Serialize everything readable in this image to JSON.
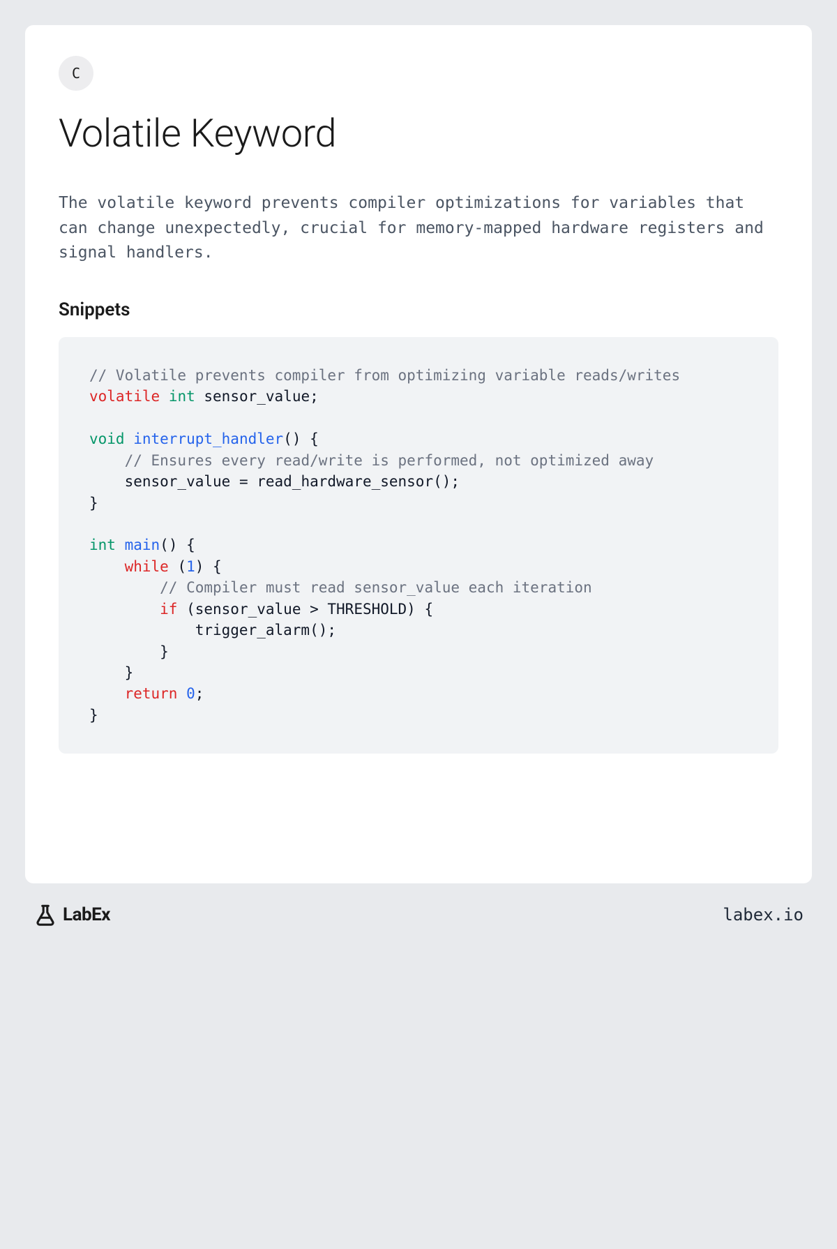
{
  "lang_badge": "C",
  "title": "Volatile Keyword",
  "description": "The volatile keyword prevents compiler optimizations for variables that can change unexpectedly, crucial for memory-mapped hardware registers and signal handlers.",
  "section_heading": "Snippets",
  "code": {
    "c1": "// Volatile prevents compiler from optimizing variable reads/writes",
    "kw_volatile": "volatile",
    "kw_int1": "int",
    "var_sensor": " sensor_value;",
    "kw_void": "void",
    "fn_interrupt": "interrupt_handler",
    "paren_brace1": "() {",
    "c2": "// Ensures every read/write is performed, not optimized away",
    "line_assign": "    sensor_value = read_hardware_sensor();",
    "brace_close1": "}",
    "kw_int2": "int",
    "fn_main": "main",
    "paren_brace2": "() {",
    "kw_while": "while",
    "while_open": " (",
    "num_1": "1",
    "while_close": ") {",
    "c3": "// Compiler must read sensor_value each iteration",
    "kw_if": "if",
    "if_cond": " (sensor_value > THRESHOLD) {",
    "trigger_line": "            trigger_alarm();",
    "brace_close_if": "        }",
    "brace_close_while": "    }",
    "kw_return": "return",
    "num_0": "0",
    "semi": ";",
    "brace_close_main": "}"
  },
  "footer": {
    "logo_text": "LabEx",
    "site_url": "labex.io"
  }
}
